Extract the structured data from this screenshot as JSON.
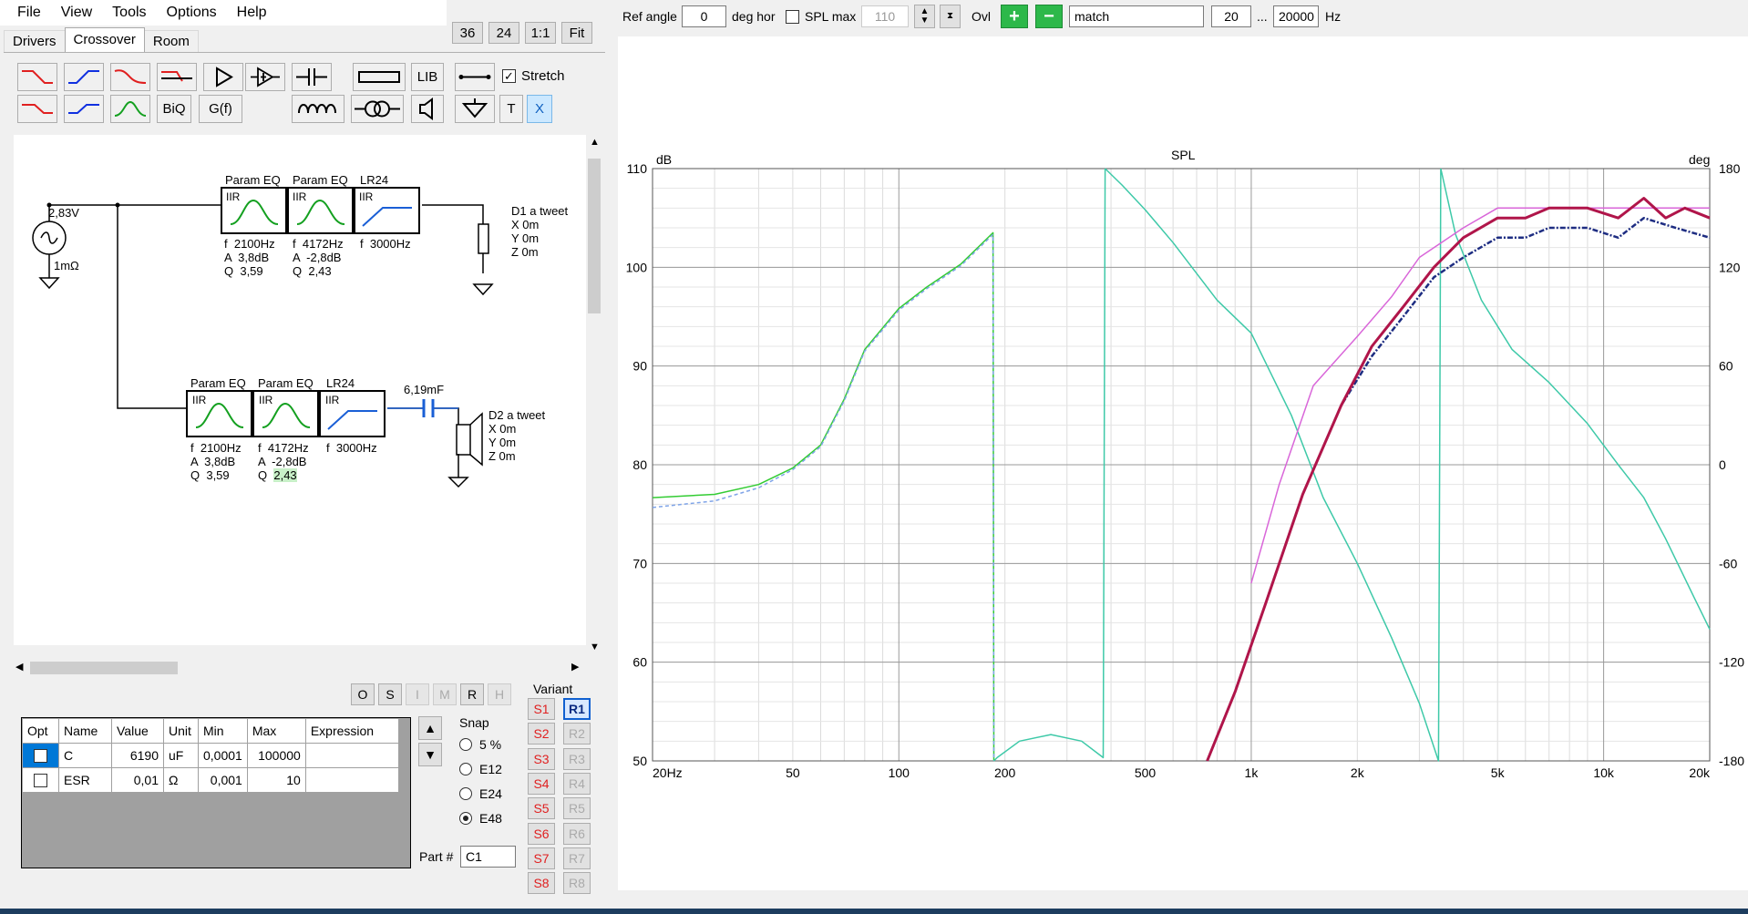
{
  "menu": [
    "File",
    "View",
    "Tools",
    "Options",
    "Help"
  ],
  "tabs": {
    "drivers": "Drivers",
    "crossover": "Crossover",
    "room": "Room"
  },
  "view_buttons": {
    "a": "36",
    "b": "24",
    "c": "1:1",
    "d": "Fit"
  },
  "toolbar": {
    "lib": "LIB",
    "biq": "BiQ",
    "gf": "G(f)",
    "t": "T",
    "x": "X",
    "stretch_label": "Stretch",
    "stretch_checked": true
  },
  "schematic": {
    "source_voltage": "2,83V",
    "source_impedance": "1mΩ",
    "row1": {
      "blocks": [
        {
          "title": "Param EQ",
          "tag": "IIR",
          "f": "f  2100Hz",
          "a": "A  3,8dB",
          "q": "Q  3,59"
        },
        {
          "title": "Param EQ",
          "tag": "IIR",
          "f": "f  4172Hz",
          "a": "A  -2,8dB",
          "q": "Q  2,43"
        },
        {
          "title": "LR24",
          "tag": "IIR",
          "f": "f  3000Hz"
        }
      ],
      "driver": {
        "name": "D1 a tweet",
        "x": "X 0m",
        "y": "Y 0m",
        "z": "Z 0m"
      }
    },
    "row2": {
      "blocks": [
        {
          "title": "Param EQ",
          "tag": "IIR",
          "f": "f  2100Hz",
          "a": "A  3,8dB",
          "q": "Q  3,59"
        },
        {
          "title": "Param EQ",
          "tag": "IIR",
          "f": "f  4172Hz",
          "a": "A  -2,8dB",
          "q_label": "Q",
          "q_val": "2,43"
        },
        {
          "title": "LR24",
          "tag": "IIR",
          "f": "f  3000Hz"
        }
      ],
      "cap": "6,19mF",
      "driver": {
        "name": "D2 a tweet",
        "x": "X 0m",
        "y": "Y 0m",
        "z": "Z 0m"
      }
    }
  },
  "small_buttons": [
    "O",
    "S",
    "I",
    "M",
    "R",
    "H"
  ],
  "params": {
    "headers": [
      "Opt",
      "Name",
      "Value",
      "Unit",
      "Min",
      "Max",
      "Expression"
    ],
    "rows": [
      {
        "opt": false,
        "name": "C",
        "value": "6190",
        "unit": "uF",
        "min": "0,0001",
        "max": "100000",
        "expr": ""
      },
      {
        "opt": false,
        "name": "ESR",
        "value": "0,01",
        "unit": "Ω",
        "min": "0,001",
        "max": "10",
        "expr": ""
      }
    ]
  },
  "snap": {
    "title": "Snap",
    "options": [
      "5 %",
      "E12",
      "E24",
      "E48"
    ],
    "selected": "E48"
  },
  "part": {
    "label": "Part #",
    "value": "C1"
  },
  "variant": {
    "title": "Variant",
    "s": [
      "S1",
      "S2",
      "S3",
      "S4",
      "S5",
      "S6",
      "S7",
      "S8"
    ],
    "r": [
      "R1",
      "R2",
      "R3",
      "R4",
      "R5",
      "R6",
      "R7",
      "R8"
    ],
    "active_r": "R1"
  },
  "top_controls": {
    "ref_angle_label": "Ref angle",
    "ref_angle": "0",
    "deg_hor": "deg hor",
    "spl_max_label": "SPL max",
    "spl_max": "110",
    "ovl": "Ovl",
    "match": "match",
    "f_min": "20",
    "ellipsis": "...",
    "f_max": "20000",
    "hz": "Hz"
  },
  "chart_data": {
    "type": "line",
    "title": "SPL",
    "ylabel": "dB",
    "y2label": "deg",
    "xscale": "log",
    "xlim": [
      20,
      20000
    ],
    "ylim": [
      50,
      110
    ],
    "y2lim": [
      -180,
      180
    ],
    "xticks": [
      20,
      50,
      100,
      200,
      500,
      1000,
      2000,
      5000,
      10000,
      20000
    ],
    "xticklabels": [
      "20Hz",
      "50",
      "100",
      "200",
      "500",
      "1k",
      "2k",
      "5k",
      "10k",
      "20k"
    ],
    "yticks": [
      50,
      60,
      70,
      80,
      90,
      100,
      110
    ],
    "y2ticks": [
      -180,
      -120,
      -60,
      0,
      60,
      120,
      180
    ],
    "grid": true,
    "series": [
      {
        "color": "#33cc33",
        "axis": "deg",
        "style": "solid",
        "x": [
          20,
          30,
          40,
          50,
          60,
          70,
          80,
          100,
          120,
          150,
          185,
          186
        ],
        "y": [
          -20,
          -18,
          -12,
          -2,
          12,
          40,
          70,
          95,
          108,
          122,
          141,
          -180
        ]
      },
      {
        "color": "#7fa4e8",
        "axis": "deg",
        "style": "dashed",
        "x": [
          20,
          30,
          40,
          50,
          60,
          70,
          80,
          100,
          120,
          150,
          185,
          186
        ],
        "y": [
          -26,
          -22,
          -14,
          -3,
          11,
          39,
          69,
          94,
          107,
          121,
          140,
          -180
        ]
      },
      {
        "color": "#3ec9a8",
        "axis": "deg",
        "style": "solid",
        "x": [
          186,
          190,
          220,
          270,
          330,
          380,
          385
        ],
        "y": [
          -180,
          -178,
          -168,
          -164,
          -168,
          -178,
          180
        ],
        "x2": [
          385,
          430,
          500,
          600,
          800,
          1000,
          1300,
          1600,
          2000,
          2500,
          3000,
          3400,
          3450
        ],
        "y2": [
          180,
          170,
          155,
          135,
          100,
          80,
          30,
          -20,
          -60,
          -105,
          -145,
          -180,
          180
        ],
        "x3": [
          3450,
          3800,
          4500,
          5500,
          7000,
          9000,
          11000,
          13000,
          15000,
          18000,
          20000
        ],
        "y3": [
          180,
          140,
          100,
          70,
          50,
          25,
          0,
          -20,
          -45,
          -80,
          -100
        ]
      },
      {
        "color": "#d966d9",
        "axis": "dB",
        "style": "solid",
        "x": [
          1000,
          1200,
          1500,
          2000,
          2500,
          3000,
          4000,
          5000,
          7000,
          10000,
          15000,
          20000
        ],
        "y": [
          68,
          78,
          88,
          93,
          97,
          101,
          104,
          106,
          106,
          106,
          106,
          106
        ]
      },
      {
        "color": "#1e2d82",
        "axis": "dB",
        "style": "dashdot",
        "x": [
          750,
          900,
          1100,
          1400,
          1800,
          2200,
          2700,
          3300,
          4000,
          5000,
          6000,
          7000,
          9000,
          11000,
          13000,
          16000,
          20000
        ],
        "y": [
          50,
          57,
          66,
          77,
          86,
          91,
          95,
          99,
          101,
          103,
          103,
          104,
          104,
          103,
          105,
          104,
          103
        ]
      },
      {
        "color": "#b0154a",
        "axis": "dB",
        "style": "solid",
        "x": [
          750,
          900,
          1100,
          1400,
          1800,
          2200,
          2700,
          3300,
          4000,
          5000,
          6000,
          7000,
          9000,
          11000,
          13000,
          15000,
          17000,
          20000
        ],
        "y": [
          50,
          57,
          66,
          77,
          86,
          92,
          96,
          100,
          103,
          105,
          105,
          106,
          106,
          105,
          107,
          105,
          106,
          105
        ]
      }
    ]
  }
}
